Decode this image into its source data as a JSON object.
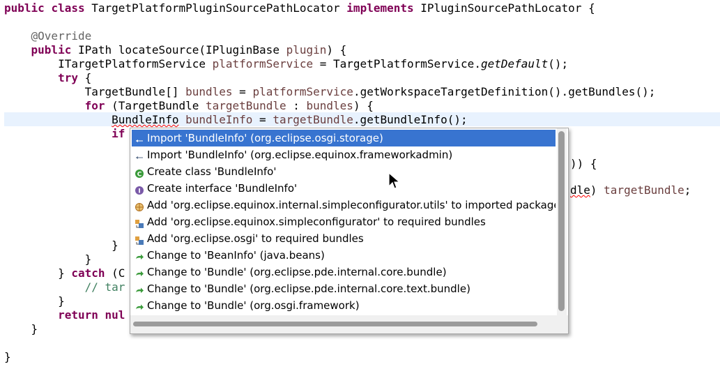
{
  "editor": {
    "lines": [
      {
        "tokens": [
          [
            "kw",
            "public"
          ],
          [
            "",
            " "
          ],
          [
            "kw",
            "class"
          ],
          [
            "",
            " TargetPlatformPluginSourcePathLocator "
          ],
          [
            "kw",
            "implements"
          ],
          [
            "",
            " IPluginSourcePathLocator {"
          ]
        ]
      },
      {
        "tokens": []
      },
      {
        "tokens": [
          [
            "",
            "    "
          ],
          [
            "ann",
            "@Override"
          ]
        ]
      },
      {
        "tokens": [
          [
            "",
            "    "
          ],
          [
            "kw",
            "public"
          ],
          [
            "",
            " IPath locateSource(IPluginBase "
          ],
          [
            "fld",
            "plugin"
          ],
          [
            "",
            ") {"
          ]
        ]
      },
      {
        "tokens": [
          [
            "",
            "        ITargetPlatformService "
          ],
          [
            "fld",
            "platformService"
          ],
          [
            "",
            " = TargetPlatformService."
          ],
          [
            "it",
            "getDefault"
          ],
          [
            "",
            "();"
          ]
        ]
      },
      {
        "tokens": [
          [
            "",
            "        "
          ],
          [
            "kw",
            "try"
          ],
          [
            "",
            " {"
          ]
        ]
      },
      {
        "tokens": [
          [
            "",
            "            TargetBundle[] "
          ],
          [
            "fld",
            "bundles"
          ],
          [
            "",
            " = "
          ],
          [
            "fld",
            "platformService"
          ],
          [
            "",
            ".getWorkspaceTargetDefinition().getBundles();"
          ]
        ]
      },
      {
        "tokens": [
          [
            "",
            "            "
          ],
          [
            "kw",
            "for"
          ],
          [
            "",
            " (TargetBundle "
          ],
          [
            "fld",
            "targetBundle"
          ],
          [
            "",
            " : "
          ],
          [
            "fld",
            "bundles"
          ],
          [
            "",
            ") {"
          ]
        ]
      },
      {
        "tokens": [
          [
            "",
            "                "
          ],
          [
            "err",
            "BundleInfo"
          ],
          [
            "",
            " "
          ],
          [
            "fld",
            "bundleInfo"
          ],
          [
            "",
            " = "
          ],
          [
            "fld",
            "targetBundle"
          ],
          [
            "",
            ".getBundleInfo();"
          ]
        ]
      },
      {
        "tokens": [
          [
            "",
            "                "
          ],
          [
            "kw",
            "if"
          ]
        ]
      },
      {
        "tokens": []
      },
      {
        "tokens": []
      },
      {
        "tokens": []
      },
      {
        "tokens": []
      },
      {
        "tokens": []
      },
      {
        "tokens": []
      },
      {
        "tokens": []
      },
      {
        "tokens": [
          [
            "",
            "                }"
          ]
        ]
      },
      {
        "tokens": [
          [
            "",
            "            }"
          ]
        ]
      },
      {
        "tokens": [
          [
            "",
            "        } "
          ],
          [
            "kw",
            "catch"
          ],
          [
            "",
            " (C"
          ]
        ]
      },
      {
        "tokens": [
          [
            "",
            "            "
          ],
          [
            "com",
            "// tar"
          ]
        ]
      },
      {
        "tokens": [
          [
            "",
            "        }"
          ]
        ]
      },
      {
        "tokens": [
          [
            "",
            "        "
          ],
          [
            "kw",
            "return"
          ],
          [
            "",
            " "
          ],
          [
            "kw",
            "nul"
          ]
        ]
      },
      {
        "tokens": [
          [
            "",
            "    }"
          ]
        ]
      },
      {
        "tokens": []
      },
      {
        "tokens": [
          [
            "",
            "}"
          ]
        ]
      }
    ],
    "right_fragments": {
      "brace": ")) {",
      "cast_err": "dle",
      "cast_rest": ") ",
      "cast_var": "targetBundle",
      "cast_end": ";"
    }
  },
  "popup": {
    "items": [
      {
        "label": "Import 'BundleInfo' (org.eclipse.osgi.storage)",
        "icon": "import-icon",
        "selected": true
      },
      {
        "label": "Import 'BundleInfo' (org.eclipse.equinox.frameworkadmin)",
        "icon": "import-icon",
        "selected": false
      },
      {
        "label": "Create class 'BundleInfo'",
        "icon": "class-icon",
        "selected": false
      },
      {
        "label": "Create interface 'BundleInfo'",
        "icon": "interface-icon",
        "selected": false
      },
      {
        "label": "Add 'org.eclipse.equinox.internal.simpleconfigurator.utils' to imported packages",
        "icon": "package-icon",
        "selected": false
      },
      {
        "label": "Add 'org.eclipse.equinox.simpleconfigurator' to required bundles",
        "icon": "bundle-icon",
        "selected": false
      },
      {
        "label": "Add 'org.eclipse.osgi' to required bundles",
        "icon": "bundle-icon",
        "selected": false
      },
      {
        "label": "Change to 'BeanInfo' (java.beans)",
        "icon": "change-icon",
        "selected": false
      },
      {
        "label": "Change to 'Bundle' (org.eclipse.pde.internal.core.bundle)",
        "icon": "change-icon",
        "selected": false
      },
      {
        "label": "Change to 'Bundle' (org.eclipse.pde.internal.core.text.bundle)",
        "icon": "change-icon",
        "selected": false
      },
      {
        "label": "Change to 'Bundle' (org.osgi.framework)",
        "icon": "change-icon",
        "selected": false
      }
    ]
  },
  "colors": {
    "selection": "#3874d0",
    "keyword": "#7f0055",
    "field": "#6a3e3e",
    "comment": "#3f7f5f",
    "annotation": "#646464",
    "current_line": "#e8f2fe"
  }
}
